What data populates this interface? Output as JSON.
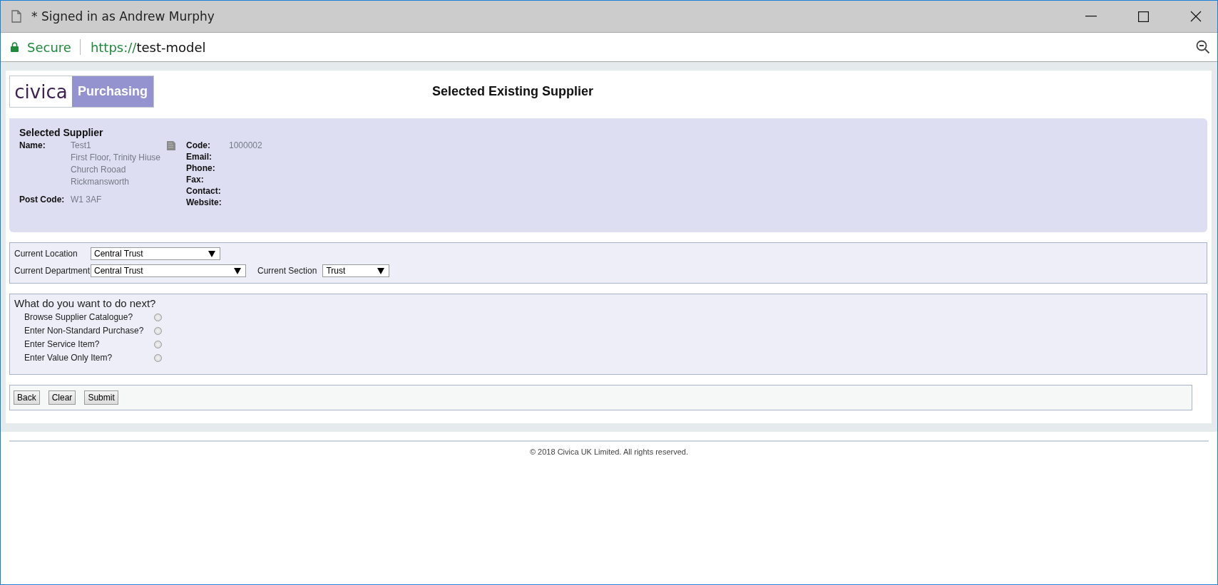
{
  "window": {
    "title": "* Signed in as Andrew Murphy"
  },
  "address_bar": {
    "security": "Secure",
    "scheme": "https://",
    "host": "test-model"
  },
  "logo": {
    "brand": "civica",
    "product": "Purchasing"
  },
  "page_title": "Selected Existing Supplier",
  "supplier": {
    "heading": "Selected Supplier",
    "left": [
      {
        "label": "Name:",
        "lines": [
          "Test1",
          "First Floor, Trinity Hiuse",
          "Church Rooad",
          "Rickmansworth"
        ]
      },
      {
        "label": "Post Code:",
        "lines": [
          "W1 3AF"
        ]
      }
    ],
    "right": [
      {
        "label": "Code:",
        "value": "1000002"
      },
      {
        "label": "Email:"
      },
      {
        "label": "Phone:"
      },
      {
        "label": "Fax:"
      },
      {
        "label": "Contact:"
      },
      {
        "label": "Website:"
      }
    ]
  },
  "location": {
    "rows": [
      [
        {
          "label": "Current Location",
          "value": "Central Trust"
        }
      ],
      [
        {
          "label": "Current Department",
          "value": "Central Trust"
        },
        {
          "label": "Current Section",
          "value": "Trust"
        }
      ]
    ]
  },
  "next": {
    "question": "What do you want to do next?",
    "options": [
      {
        "label": "Browse Supplier Catalogue?",
        "selected": false
      },
      {
        "label": "Enter Non-Standard Purchase?",
        "selected": false
      },
      {
        "label": "Enter Service Item?",
        "selected": false
      },
      {
        "label": "Enter Value Only Item?",
        "selected": false
      }
    ]
  },
  "buttons": [
    "Back",
    "Clear",
    "Submit"
  ],
  "footer": "© 2018 Civica UK Limited. All rights reserved."
}
